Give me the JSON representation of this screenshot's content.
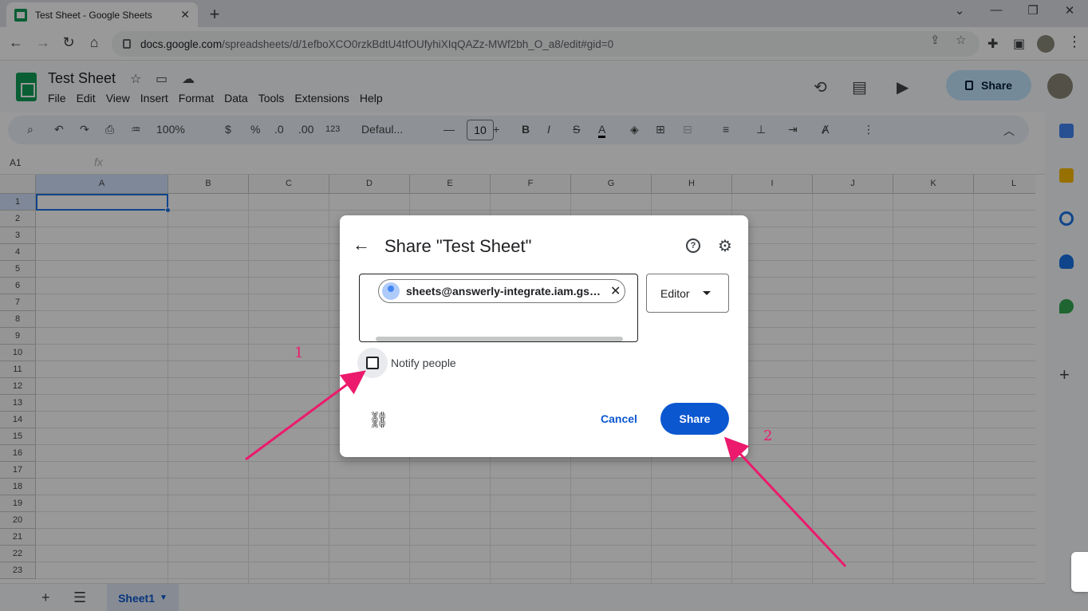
{
  "browser": {
    "tab_title": "Test Sheet - Google Sheets",
    "url_domain": "docs.google.com",
    "url_path": "/spreadsheets/d/1efboXCO0rzkBdtU4tfOUfyhiXIqQAZz-MWf2bh_O_a8/edit#gid=0"
  },
  "app": {
    "doc_title": "Test Sheet",
    "menu": [
      "File",
      "Edit",
      "View",
      "Insert",
      "Format",
      "Data",
      "Tools",
      "Extensions",
      "Help"
    ],
    "share_label": "Share",
    "toolbar": {
      "zoom": "100%",
      "currency": "$",
      "percent": "%",
      "dec_decrease": ".0",
      "dec_increase": ".00",
      "number_format": "123",
      "font": "Defaul...",
      "font_size": "10"
    },
    "name_box": "A1",
    "fx": "fx",
    "columns": [
      "A",
      "B",
      "C",
      "D",
      "E",
      "F",
      "G",
      "H",
      "I",
      "J",
      "K",
      "L"
    ],
    "rows": [
      "1",
      "2",
      "3",
      "4",
      "5",
      "6",
      "7",
      "8",
      "9",
      "10",
      "11",
      "12",
      "13",
      "14",
      "15",
      "16",
      "17",
      "18",
      "19",
      "20",
      "21",
      "22",
      "23"
    ],
    "sheet_tab": "Sheet1"
  },
  "dialog": {
    "title": "Share \"Test Sheet\"",
    "chip_email": "sheets@answerly-integrate.iam.gserviceaccount.com",
    "role": "Editor",
    "notify_label": "Notify people",
    "notify_checked": false,
    "cancel": "Cancel",
    "share": "Share"
  },
  "annotations": {
    "step1": "1",
    "step2": "2",
    "arrow_color": "#ec1a6c"
  },
  "colors": {
    "primary": "#0b57d0",
    "share_pill": "#c2e7ff",
    "sheets_green": "#0f9d58"
  }
}
